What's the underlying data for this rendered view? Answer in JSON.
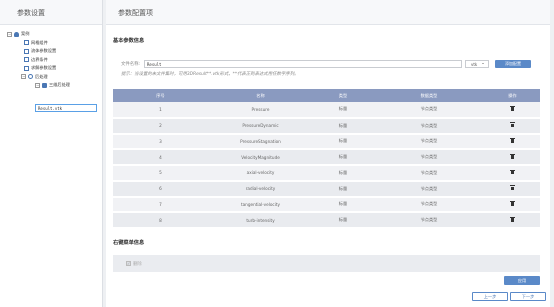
{
  "left": {
    "title": "参数设置",
    "tree": {
      "root": "案例",
      "item1": "网格组件",
      "item2": "流体参数设置",
      "item3": "边界条件",
      "item4": "求解参数设置",
      "post": "后处理",
      "post_child": "三维后处理",
      "editor_value": "Result.vtk"
    }
  },
  "main": {
    "title": "参数配置项",
    "basic_title": "基本参数信息",
    "file": {
      "label": "文件名称:",
      "value": "Result",
      "select_value": "vtk",
      "add_button": "添加配置"
    },
    "hint": "提示：当设置的未文件集时，可用3DResult**.vtk形式，**代表正则表达式用任数字序列。",
    "table": {
      "headers": [
        "序号",
        "名称",
        "类型",
        "数据类型",
        "操作"
      ],
      "rows": [
        {
          "no": "1",
          "name": "Pressure",
          "type": "标量",
          "dtype": "节点类型"
        },
        {
          "no": "2",
          "name": "PressureDynamic",
          "type": "标量",
          "dtype": "节点类型"
        },
        {
          "no": "3",
          "name": "PressureStagnation",
          "type": "标量",
          "dtype": "节点类型"
        },
        {
          "no": "4",
          "name": "VelocityMagnitude",
          "type": "标量",
          "dtype": "节点类型"
        },
        {
          "no": "5",
          "name": "axial-velocity",
          "type": "标量",
          "dtype": "节点类型"
        },
        {
          "no": "6",
          "name": "radial-velocity",
          "type": "标量",
          "dtype": "节点类型"
        },
        {
          "no": "7",
          "name": "tangential-velocity",
          "type": "标量",
          "dtype": "节点类型"
        },
        {
          "no": "8",
          "name": "turb-intensity",
          "type": "标量",
          "dtype": "节点类型"
        }
      ]
    },
    "right_menu_title": "右键菜单信息",
    "checkbox_label": "删除",
    "save_button": "应用",
    "prev_button": "上一步",
    "next_button": "下一步"
  }
}
